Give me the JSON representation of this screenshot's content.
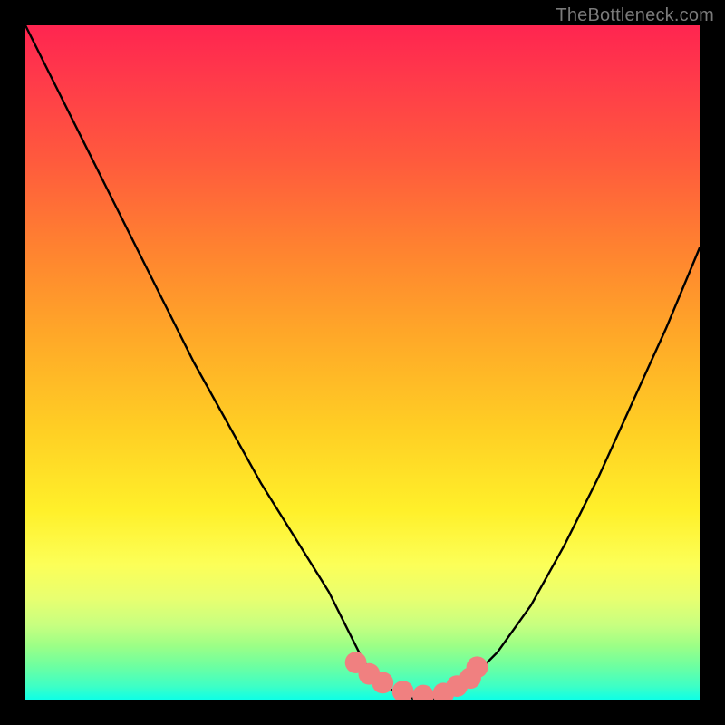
{
  "watermark": "TheBottleneck.com",
  "chart_data": {
    "type": "line",
    "title": "",
    "xlabel": "",
    "ylabel": "",
    "xlim": [
      0,
      100
    ],
    "ylim": [
      0,
      100
    ],
    "grid": false,
    "legend": false,
    "series": [
      {
        "name": "bottleneck-curve",
        "color": "#000000",
        "x": [
          0,
          5,
          10,
          15,
          20,
          25,
          30,
          35,
          40,
          45,
          48,
          50,
          52,
          55,
          58,
          60,
          63,
          66,
          70,
          75,
          80,
          85,
          90,
          95,
          100
        ],
        "y": [
          100,
          90,
          80,
          70,
          60,
          50,
          41,
          32,
          24,
          16,
          10,
          6,
          3,
          1,
          0,
          0,
          1,
          3,
          7,
          14,
          23,
          33,
          44,
          55,
          67
        ]
      }
    ],
    "markers": [
      {
        "name": "highlight-dots",
        "color": "#f08080",
        "radius_percent": 1.6,
        "x": [
          49,
          51,
          53,
          56,
          59,
          62,
          64,
          66,
          67
        ],
        "y": [
          5.5,
          3.8,
          2.5,
          1.2,
          0.6,
          0.9,
          2.0,
          3.2,
          4.8
        ]
      }
    ]
  }
}
